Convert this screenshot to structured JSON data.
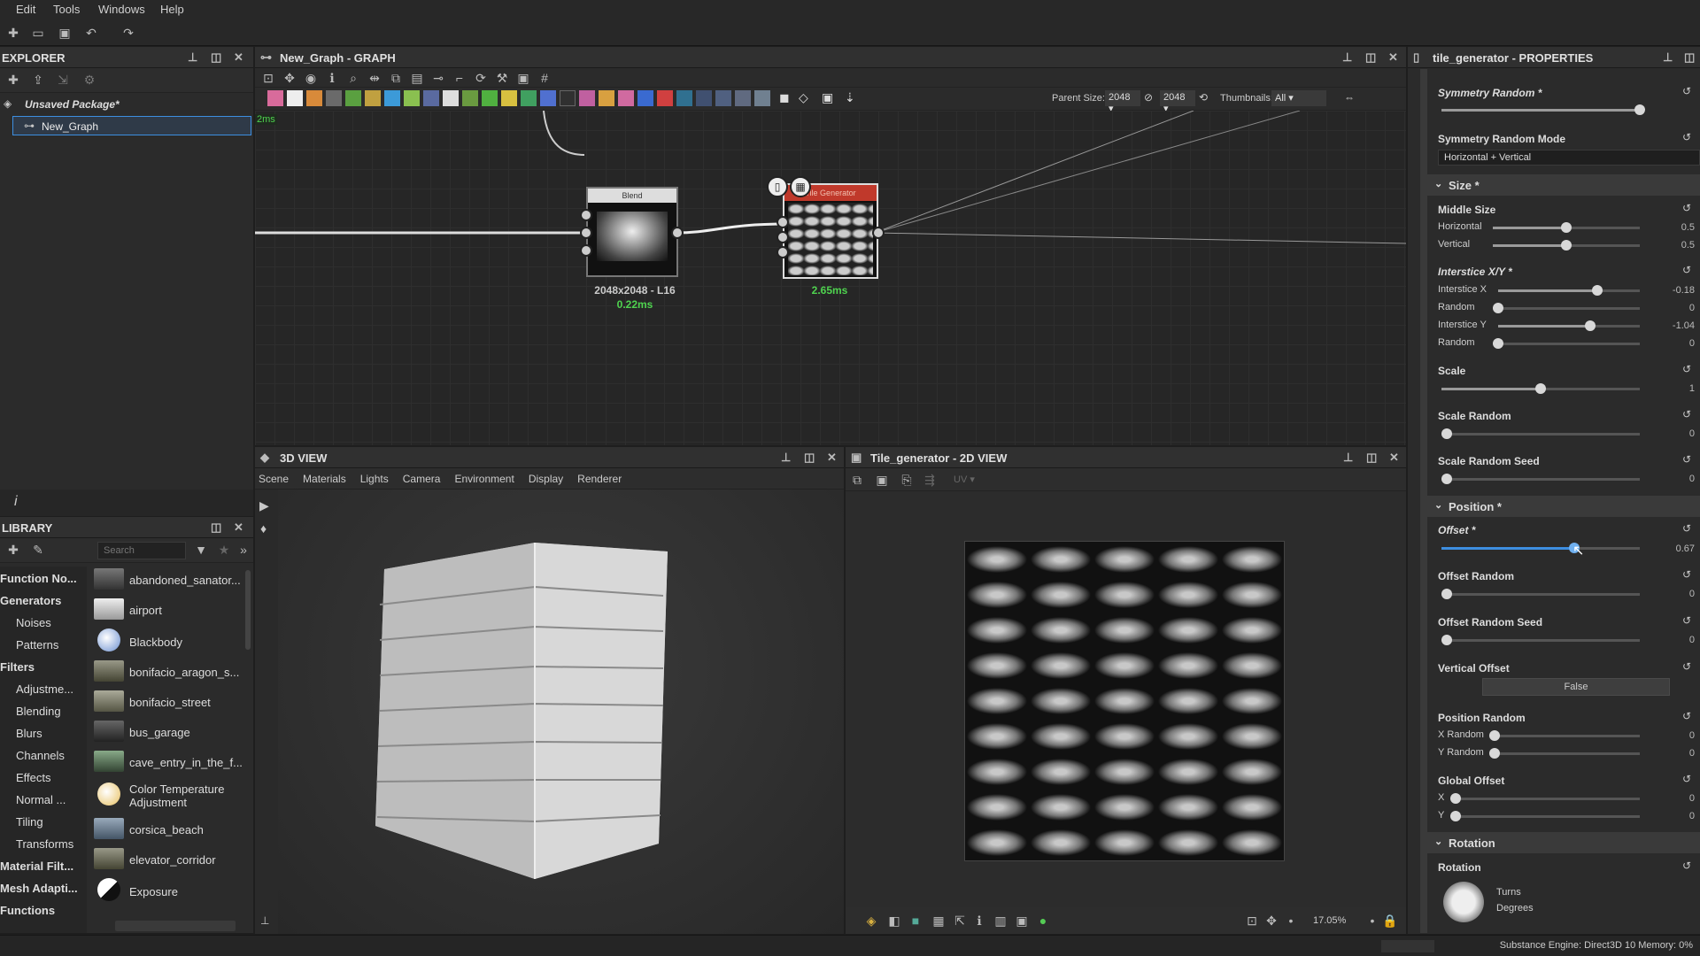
{
  "menu": [
    "Edit",
    "Tools",
    "Windows",
    "Help"
  ],
  "explorer": {
    "title": "EXPLORER",
    "package": "Unsaved Package*",
    "graph": "New_Graph"
  },
  "graph_panel": {
    "title": "New_Graph - GRAPH",
    "parent_size_label": "Parent Size:",
    "parent_size_value": "2048",
    "size_value_2": "2048",
    "thumbnails_label": "Thumbnails:",
    "thumbnails_value": "All",
    "timing": "2ms",
    "nodes": [
      {
        "name": "Blend",
        "info": "2048x2048 - L16",
        "time": "0.22ms"
      },
      {
        "name": "Tile Generator",
        "info": "",
        "time": "2.65ms"
      }
    ]
  },
  "library": {
    "title": "LIBRARY",
    "search_placeholder": "Search",
    "categories": [
      "Function No...",
      "Generators",
      "Noises",
      "Patterns",
      "Filters",
      "Adjustme...",
      "Blending",
      "Blurs",
      "Channels",
      "Effects",
      "Normal ...",
      "Tiling",
      "Transforms",
      "Material Filt...",
      "Mesh Adapti...",
      "Functions"
    ],
    "items": [
      "abandoned_sanator...",
      "airport",
      "Blackbody",
      "bonifacio_aragon_s...",
      "bonifacio_street",
      "bus_garage",
      "cave_entry_in_the_f...",
      "Color Temperature Adjustment",
      "corsica_beach",
      "elevator_corridor",
      "Exposure"
    ]
  },
  "view3d": {
    "title": "3D VIEW",
    "menu": [
      "Scene",
      "Materials",
      "Lights",
      "Camera",
      "Environment",
      "Display",
      "Renderer"
    ]
  },
  "view2d": {
    "title": "Tile_generator - 2D VIEW",
    "uv_label": "UV",
    "zoom": "17.05%"
  },
  "properties": {
    "title": "tile_generator - PROPERTIES",
    "symmetry_random": {
      "label": "Symmetry Random *",
      "value": 0.95
    },
    "symmetry_random_mode": {
      "label": "Symmetry Random Mode",
      "value": "Horizontal + Vertical"
    },
    "sections": {
      "size": "Size *",
      "position": "Position *",
      "rotation": "Rotation"
    },
    "middle_size": {
      "label": "Middle Size",
      "horizontal": {
        "label": "Horizontal",
        "value": "0.5"
      },
      "vertical": {
        "label": "Vertical",
        "value": "0.5"
      }
    },
    "interstice": {
      "label": "Interstice X/Y *",
      "x_label": "Interstice X",
      "x_value": "-0.18",
      "random_label": "Random",
      "random_value": "0",
      "y_label": "Interstice Y",
      "y_value": "-1.04",
      "random2_label": "Random",
      "random2_value": "0"
    },
    "scale": {
      "label": "Scale",
      "value": "1"
    },
    "scale_random": {
      "label": "Scale Random",
      "value": "0"
    },
    "scale_random_seed": {
      "label": "Scale Random Seed",
      "value": "0"
    },
    "offset": {
      "label": "Offset *",
      "value": "0.67"
    },
    "offset_random": {
      "label": "Offset Random",
      "value": "0"
    },
    "offset_random_seed": {
      "label": "Offset Random Seed",
      "value": "0"
    },
    "vertical_offset": {
      "label": "Vertical Offset",
      "value": "False"
    },
    "position_random": {
      "label": "Position Random",
      "x_label": "X Random",
      "x_value": "0",
      "y_label": "Y Random",
      "y_value": "0"
    },
    "global_offset": {
      "label": "Global Offset",
      "x_label": "X",
      "x_value": "0",
      "y_label": "Y",
      "y_value": "0"
    },
    "rotation": {
      "label": "Rotation",
      "turns_label": "Turns",
      "degrees_label": "Degrees"
    }
  },
  "statusbar": {
    "engine": "Substance Engine: Direct3D 10  Memory: 0%"
  },
  "colors": {
    "accent": "#3d8ee0",
    "node_header_red": "#c0392b",
    "timing_green": "#4fd34f",
    "panel_bg": "#2b2b2b"
  }
}
